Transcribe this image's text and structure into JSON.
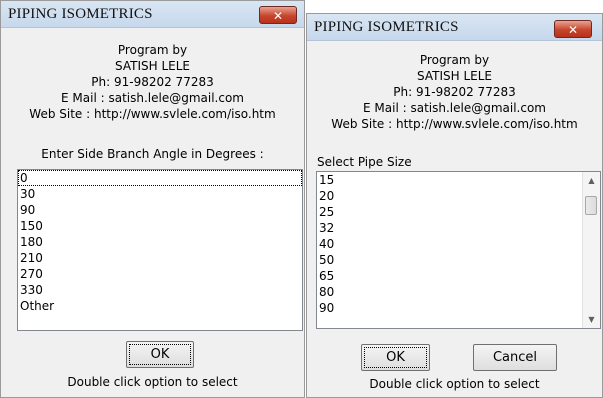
{
  "dialog1": {
    "title": "PIPING ISOMETRICS",
    "close_label": "✕",
    "info": [
      "Program by",
      "SATISH LELE",
      "Ph: 91-98202 77283",
      "E Mail : satish.lele@gmail.com",
      "Web Site : http://www.svlele.com/iso.htm"
    ],
    "prompt": "Enter Side Branch Angle in Degrees :",
    "options": [
      "0",
      "30",
      "90",
      "150",
      "180",
      "210",
      "270",
      "330",
      "Other"
    ],
    "ok_label": "OK",
    "footer": "Double click option to select"
  },
  "dialog2": {
    "title": "PIPING ISOMETRICS",
    "close_label": "✕",
    "info": [
      "Program by",
      "SATISH LELE",
      "Ph: 91-98202 77283",
      "E Mail : satish.lele@gmail.com",
      "Web Site : http://www.svlele.com/iso.htm"
    ],
    "prompt": "Select Pipe Size",
    "options": [
      "15",
      "20",
      "25",
      "32",
      "40",
      "50",
      "65",
      "80",
      "90"
    ],
    "ok_label": "OK",
    "cancel_label": "Cancel",
    "footer": "Double click option to select"
  }
}
